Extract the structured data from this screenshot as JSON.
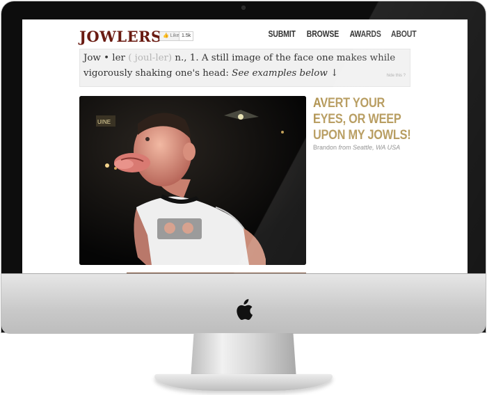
{
  "site": {
    "logo": "JOWLERS",
    "like_label": "Like",
    "like_count": "1.5k"
  },
  "nav": {
    "items": [
      "SUBMIT",
      "BROWSE",
      "AWARDS",
      "ABOUT"
    ]
  },
  "definition": {
    "word": "Jow • ler",
    "pronunciation": "( joul-ler)",
    "text": " n., 1. A still image of the face one makes while vigorously shaking one's head: ",
    "examples_link": "See examples below ↓",
    "hide_label": "hide this ?"
  },
  "post": {
    "title": "AVERT YOUR EYES, OR WEEP UPON MY JOWLS!",
    "author": "Brandon",
    "location": "from Seattle, WA USA",
    "photo_alt": "man shaking head with jowls flapping"
  },
  "colors": {
    "logo": "#6a1b12",
    "title_accent": "#b29554",
    "definition_bg": "#f1f1f1"
  },
  "icons": {
    "device_logo": "apple-logo-icon"
  }
}
